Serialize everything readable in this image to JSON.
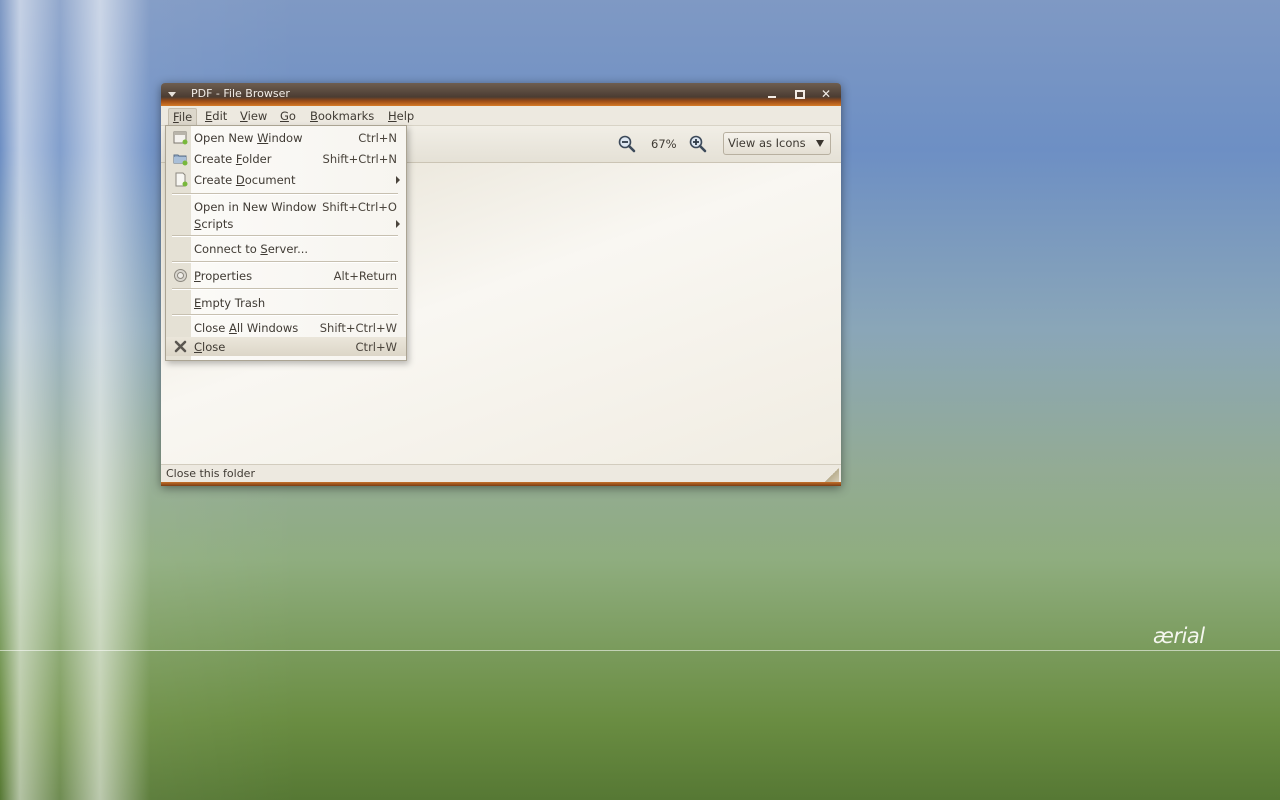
{
  "window": {
    "title": "PDF - File Browser"
  },
  "menubar": {
    "items": [
      {
        "label": "File",
        "mnemonic": "F",
        "rest": "ile"
      },
      {
        "label": "Edit",
        "mnemonic": "E",
        "rest": "dit"
      },
      {
        "label": "View",
        "mnemonic": "V",
        "rest": "iew"
      },
      {
        "label": "Go",
        "mnemonic": "G",
        "rest": "o"
      },
      {
        "label": "Bookmarks",
        "mnemonic": "B",
        "rest": "ookmarks"
      },
      {
        "label": "Help",
        "mnemonic": "H",
        "rest": "elp"
      }
    ]
  },
  "toolbar": {
    "zoom_level": "67%",
    "view_mode": "View as Icons"
  },
  "file_menu": {
    "items": [
      {
        "pre": "Open New ",
        "mn": "W",
        "post": "indow",
        "accel": "Ctrl+N",
        "icon": "new-window-icon"
      },
      {
        "pre": "Create ",
        "mn": "F",
        "post": "older",
        "accel": "Shift+Ctrl+N",
        "icon": "folder-icon"
      },
      {
        "pre": "Create ",
        "mn": "D",
        "post": "ocument",
        "accel": "",
        "icon": "document-icon",
        "submenu": true
      },
      {
        "pre": "Open in New Window",
        "mn": "",
        "post": "",
        "accel": "Shift+Ctrl+O"
      },
      {
        "pre": "",
        "mn": "S",
        "post": "cripts",
        "accel": "",
        "submenu": true
      },
      {
        "pre": "Connect to ",
        "mn": "S",
        "post": "erver...",
        "accel": ""
      },
      {
        "pre": "",
        "mn": "P",
        "post": "roperties",
        "accel": "Alt+Return",
        "icon": "properties-icon"
      },
      {
        "pre": "",
        "mn": "E",
        "post": "mpty Trash",
        "accel": ""
      },
      {
        "pre": "Close ",
        "mn": "A",
        "post": "ll Windows",
        "accel": "Shift+Ctrl+W"
      },
      {
        "pre": "",
        "mn": "C",
        "post": "lose",
        "accel": "Ctrl+W",
        "icon": "close-icon",
        "active": true
      }
    ]
  },
  "statusbar": {
    "text": "Close this folder"
  },
  "desktop": {
    "brand": "ærial"
  }
}
